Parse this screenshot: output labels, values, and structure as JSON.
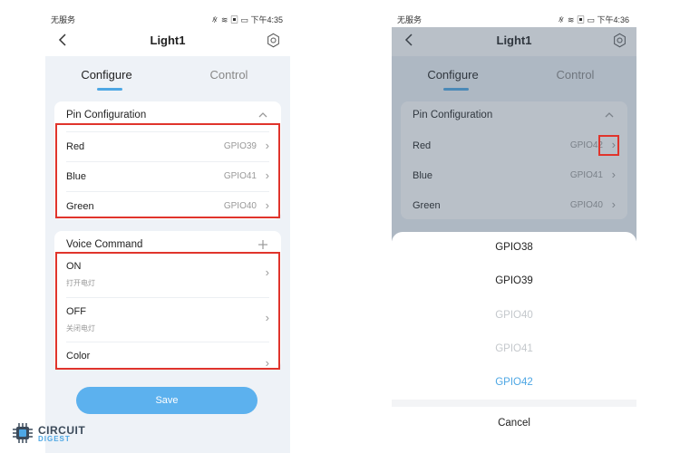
{
  "left_phone": {
    "status": {
      "carrier": "无服务",
      "right": "∦ ≋ ▣ ▭ 下午4:35"
    },
    "title": "Light1",
    "tabs": {
      "configure": "Configure",
      "control": "Control"
    },
    "pin_card": {
      "header": "Pin Configuration",
      "rows": [
        {
          "label": "Red",
          "value": "GPIO39"
        },
        {
          "label": "Blue",
          "value": "GPIO41"
        },
        {
          "label": "Green",
          "value": "GPIO40"
        }
      ]
    },
    "voice_card": {
      "header": "Voice Command",
      "rows": [
        {
          "label": "ON",
          "sub": "打开电灯"
        },
        {
          "label": "OFF",
          "sub": "关闭电灯"
        },
        {
          "label": "Color",
          "sub": ""
        }
      ]
    },
    "save_label": "Save"
  },
  "right_phone": {
    "status": {
      "carrier": "无服务",
      "right": "∦ ≋ ▣ ▭ 下午4:36"
    },
    "title": "Light1",
    "tabs": {
      "configure": "Configure",
      "control": "Control"
    },
    "pin_card": {
      "header": "Pin Configuration",
      "rows": [
        {
          "label": "Red",
          "value": "GPIO42"
        },
        {
          "label": "Blue",
          "value": "GPIO41"
        },
        {
          "label": "Green",
          "value": "GPIO40"
        }
      ]
    },
    "sheet": {
      "options": [
        {
          "label": "GPIO38",
          "state": "enabled"
        },
        {
          "label": "GPIO39",
          "state": "enabled"
        },
        {
          "label": "GPIO40",
          "state": "disabled"
        },
        {
          "label": "GPIO41",
          "state": "disabled"
        },
        {
          "label": "GPIO42",
          "state": "selected"
        }
      ],
      "cancel": "Cancel"
    }
  },
  "logo": {
    "line1": "CIRCUIT",
    "line2": "DIGEST"
  },
  "colors": {
    "accent": "#4ea7e4",
    "save_button": "#5cb1ee",
    "highlight": "#e0342c",
    "background": "#eef2f7"
  }
}
